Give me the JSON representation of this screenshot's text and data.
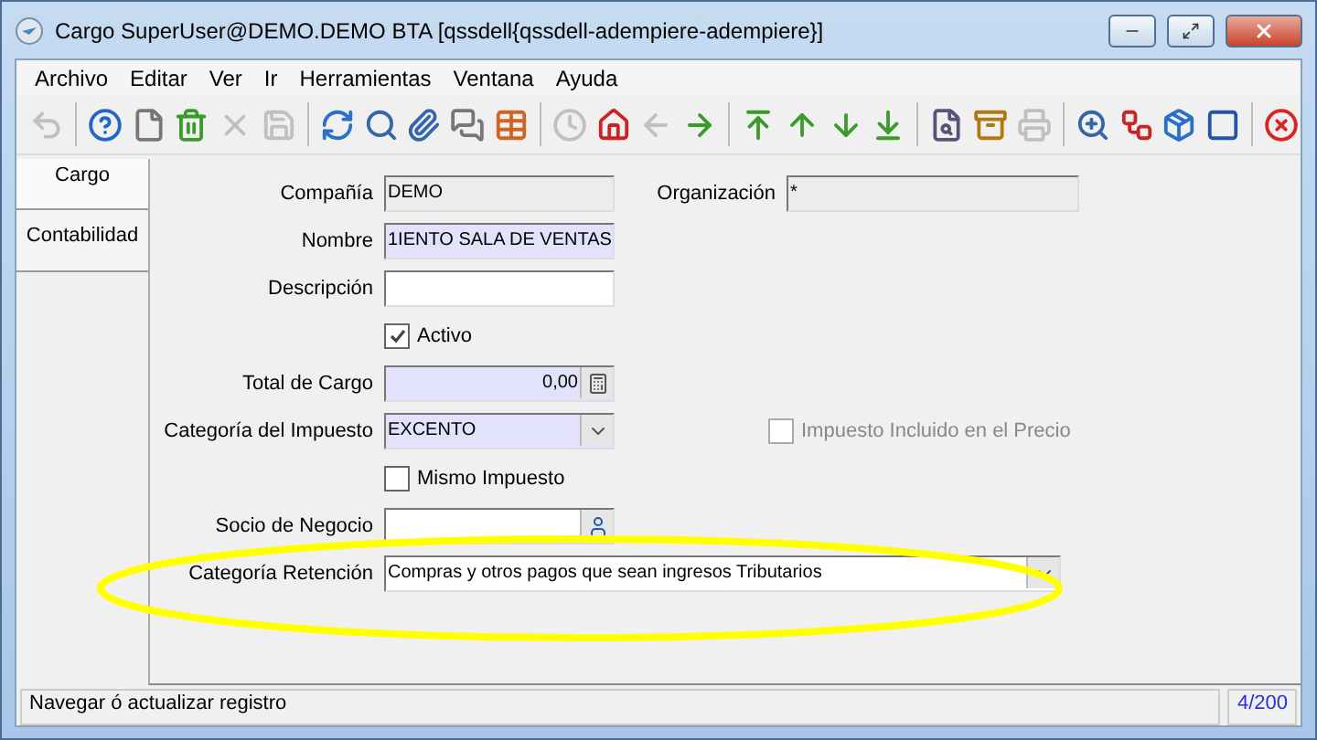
{
  "window": {
    "title": "Cargo  SuperUser@DEMO.DEMO BTA [qssdell{qssdell-adempiere-adempiere}]"
  },
  "menu": [
    "Archivo",
    "Editar",
    "Ver",
    "Ir",
    "Herramientas",
    "Ventana",
    "Ayuda"
  ],
  "toolbar": [
    {
      "kind": "undo",
      "disabled": true
    },
    {
      "kind": "help",
      "disabled": false
    },
    {
      "kind": "new",
      "disabled": false
    },
    {
      "kind": "delete",
      "disabled": false
    },
    {
      "kind": "delete_selection",
      "disabled": true
    },
    {
      "kind": "save",
      "disabled": true
    },
    {
      "kind": "refresh",
      "disabled": false
    },
    {
      "kind": "find",
      "disabled": false
    },
    {
      "kind": "attach",
      "disabled": false
    },
    {
      "kind": "chat",
      "disabled": false
    },
    {
      "kind": "grid",
      "disabled": false
    },
    {
      "kind": "history",
      "disabled": true
    },
    {
      "kind": "home",
      "disabled": false
    },
    {
      "kind": "back",
      "disabled": true
    },
    {
      "kind": "forward",
      "disabled": false
    },
    {
      "kind": "first",
      "disabled": false
    },
    {
      "kind": "prev",
      "disabled": false
    },
    {
      "kind": "next",
      "disabled": false
    },
    {
      "kind": "last",
      "disabled": false
    },
    {
      "kind": "report",
      "disabled": false
    },
    {
      "kind": "archive",
      "disabled": false
    },
    {
      "kind": "print",
      "disabled": true
    },
    {
      "kind": "zoom",
      "disabled": false
    },
    {
      "kind": "workflow",
      "disabled": false
    },
    {
      "kind": "product",
      "disabled": false
    },
    {
      "kind": "end",
      "disabled": false
    },
    {
      "kind": "exit",
      "disabled": false
    }
  ],
  "tabs": [
    {
      "label": "Cargo",
      "selected": true
    },
    {
      "label": "Contabilidad",
      "selected": false
    }
  ],
  "form": [
    {
      "kind": "text",
      "label": "Compañía",
      "value": "DEMO",
      "read_only": true,
      "aside": {
        "kind": "text",
        "label": "Organización",
        "value": "*",
        "read_only": true
      }
    },
    {
      "kind": "text",
      "label": "Nombre",
      "value": "1IENTO SALA DE VENTAS",
      "mandatory": true
    },
    {
      "kind": "text",
      "label": "Descripción"
    },
    {
      "kind": "checkbox",
      "label": "Activo",
      "checked": true,
      "disabled": false
    },
    {
      "kind": "number",
      "label": "Total de Cargo",
      "value": "0,00",
      "mandatory": true
    },
    {
      "kind": "select",
      "label": "Categoría del Impuesto",
      "value": "EXCENTO",
      "mandatory": true,
      "aside": {
        "kind": "checkbox",
        "label": "Impuesto Incluido en el Precio",
        "checked": false,
        "disabled": true
      }
    },
    {
      "kind": "checkbox",
      "label": "Mismo Impuesto",
      "checked": false,
      "disabled": false
    },
    {
      "kind": "search",
      "label": "Socio de Negocio"
    },
    {
      "kind": "wide_select",
      "label": "Categoría Retención",
      "value": "Compras y otros pagos que sean ingresos Tributarios"
    }
  ],
  "status_bar": {
    "message": "Navegar ó actualizar registro",
    "record": "4/200"
  }
}
